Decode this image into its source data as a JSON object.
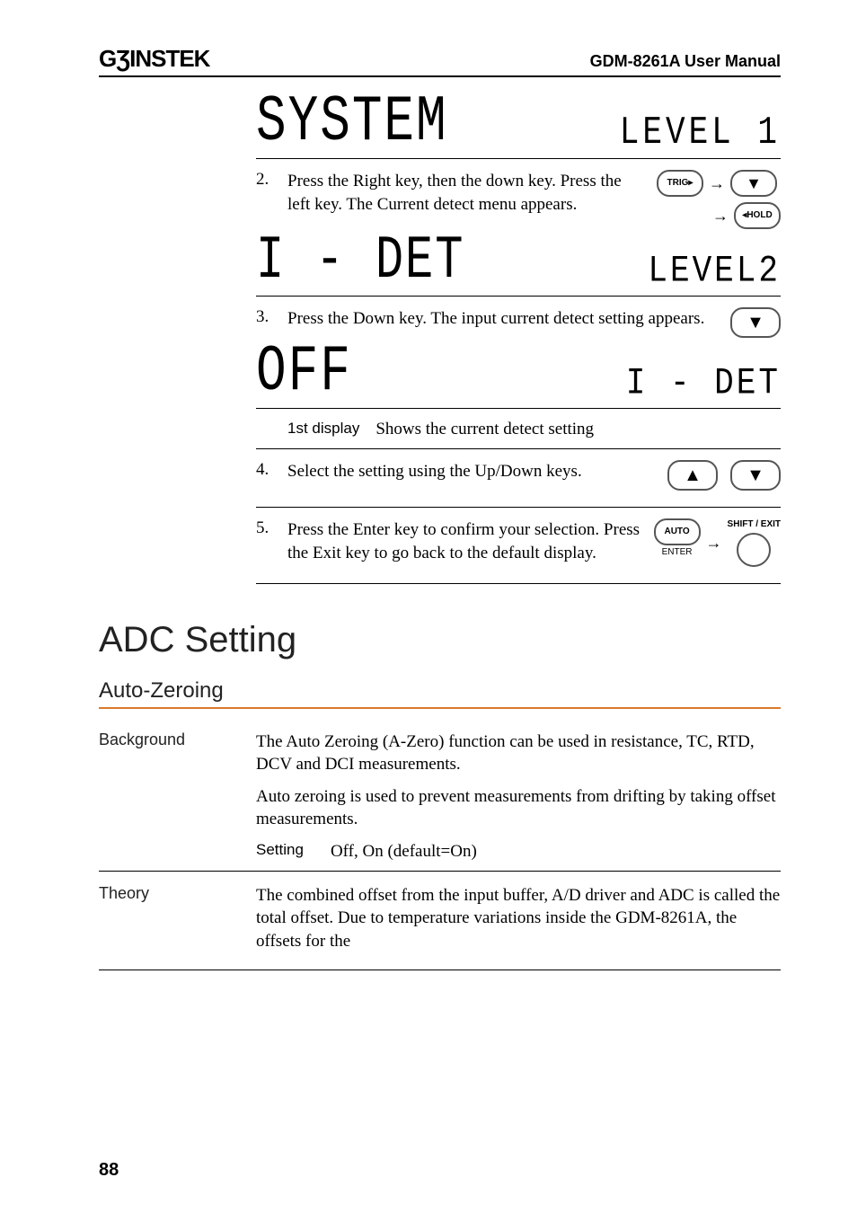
{
  "header": {
    "logo": "GƷINSTEK",
    "title": "GDM-8261A User Manual"
  },
  "lcd": {
    "system": "SYSTEM",
    "level1": "LEVEL 1",
    "idet": "I - DET",
    "level2": "LEVEL2",
    "off": "OFF",
    "idet2": "I - DET"
  },
  "steps": {
    "s2_num": "2.",
    "s2_text": "Press the Right key, then the down key. Press the left key. The Current detect menu appears.",
    "s3_num": "3.",
    "s3_text": "Press the Down key. The input current detect setting appears.",
    "display_label": "1st display",
    "display_text": "Shows the current detect setting",
    "s4_num": "4.",
    "s4_text": "Select the setting using the Up/Down keys.",
    "s5_num": "5.",
    "s5_text": "Press the Enter key to confirm your selection. Press the Exit key to go back to the default display."
  },
  "keys": {
    "trig": "TRIG▸",
    "hold": "◂HOLD",
    "auto": "AUTO",
    "enter": "ENTER",
    "shift": "SHIFT / EXIT"
  },
  "section": {
    "title": "ADC Setting",
    "subsection": "Auto-Zeroing"
  },
  "background": {
    "label": "Background",
    "p1": "The Auto Zeroing (A-Zero) function can be used in resistance, TC, RTD, DCV and DCI measurements.",
    "p2": "Auto zeroing is used to prevent measurements from drifting by taking offset measurements.",
    "setting_label": "Setting",
    "setting_value": "Off, On (default=On)"
  },
  "theory": {
    "label": "Theory",
    "p1": "The combined offset from the input buffer, A/D driver and ADC is called the total offset. Due to temperature variations inside the GDM-8261A, the offsets for the"
  },
  "page": "88"
}
